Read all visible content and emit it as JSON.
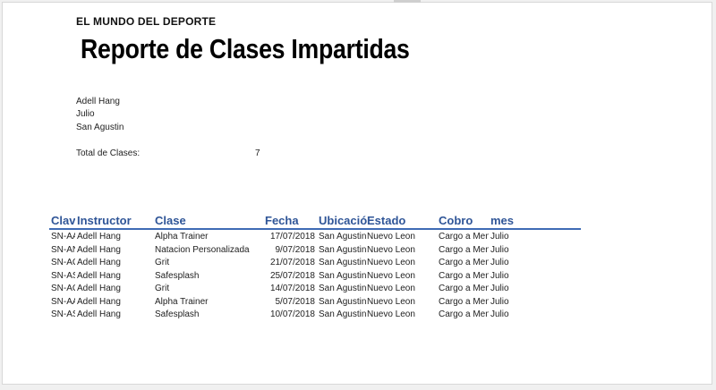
{
  "report": {
    "brand": "EL MUNDO DEL DEPORTE",
    "title": "Reporte de Clases Impartidas",
    "instructor_name": "Adell Hang",
    "month": "Julio",
    "location": "San Agustin",
    "total_label": "Total de Clases:",
    "total_value": "7"
  },
  "table": {
    "columns": [
      "Clav",
      "Instructor",
      "Clase",
      "Fecha",
      "Ubicació",
      "Estado",
      "Cobro",
      "mes"
    ],
    "rows": [
      {
        "clave": "SN-AA",
        "instructor": "Adell Hang",
        "clase": "Alpha Trainer",
        "fecha": "17/07/2018",
        "ubicacion": "San Agustin",
        "estado": "Nuevo Leon",
        "cobro": "Cargo a Men",
        "mes": "Julio"
      },
      {
        "clave": "SN-AN",
        "instructor": "Adell Hang",
        "clase": "Natacion Personalizada",
        "fecha": "9/07/2018",
        "ubicacion": "San Agustin",
        "estado": "Nuevo Leon",
        "cobro": "Cargo a Men",
        "mes": "Julio"
      },
      {
        "clave": "SN-AG",
        "instructor": "Adell Hang",
        "clase": "Grit",
        "fecha": "21/07/2018",
        "ubicacion": "San Agustin",
        "estado": "Nuevo Leon",
        "cobro": "Cargo a Men",
        "mes": "Julio"
      },
      {
        "clave": "SN-AS",
        "instructor": "Adell Hang",
        "clase": "Safesplash",
        "fecha": "25/07/2018",
        "ubicacion": "San Agustin",
        "estado": "Nuevo Leon",
        "cobro": "Cargo a Men",
        "mes": "Julio"
      },
      {
        "clave": "SN-AG",
        "instructor": "Adell Hang",
        "clase": "Grit",
        "fecha": "14/07/2018",
        "ubicacion": "San Agustin",
        "estado": "Nuevo Leon",
        "cobro": "Cargo a Men",
        "mes": "Julio"
      },
      {
        "clave": "SN-AA",
        "instructor": "Adell Hang",
        "clase": "Alpha Trainer",
        "fecha": "5/07/2018",
        "ubicacion": "San Agustin",
        "estado": "Nuevo Leon",
        "cobro": "Cargo a Men",
        "mes": "Julio"
      },
      {
        "clave": "SN-AS",
        "instructor": "Adell Hang",
        "clase": "Safesplash",
        "fecha": "10/07/2018",
        "ubicacion": "San Agustin",
        "estado": "Nuevo Leon",
        "cobro": "Cargo a Men",
        "mes": "Julio"
      }
    ]
  }
}
